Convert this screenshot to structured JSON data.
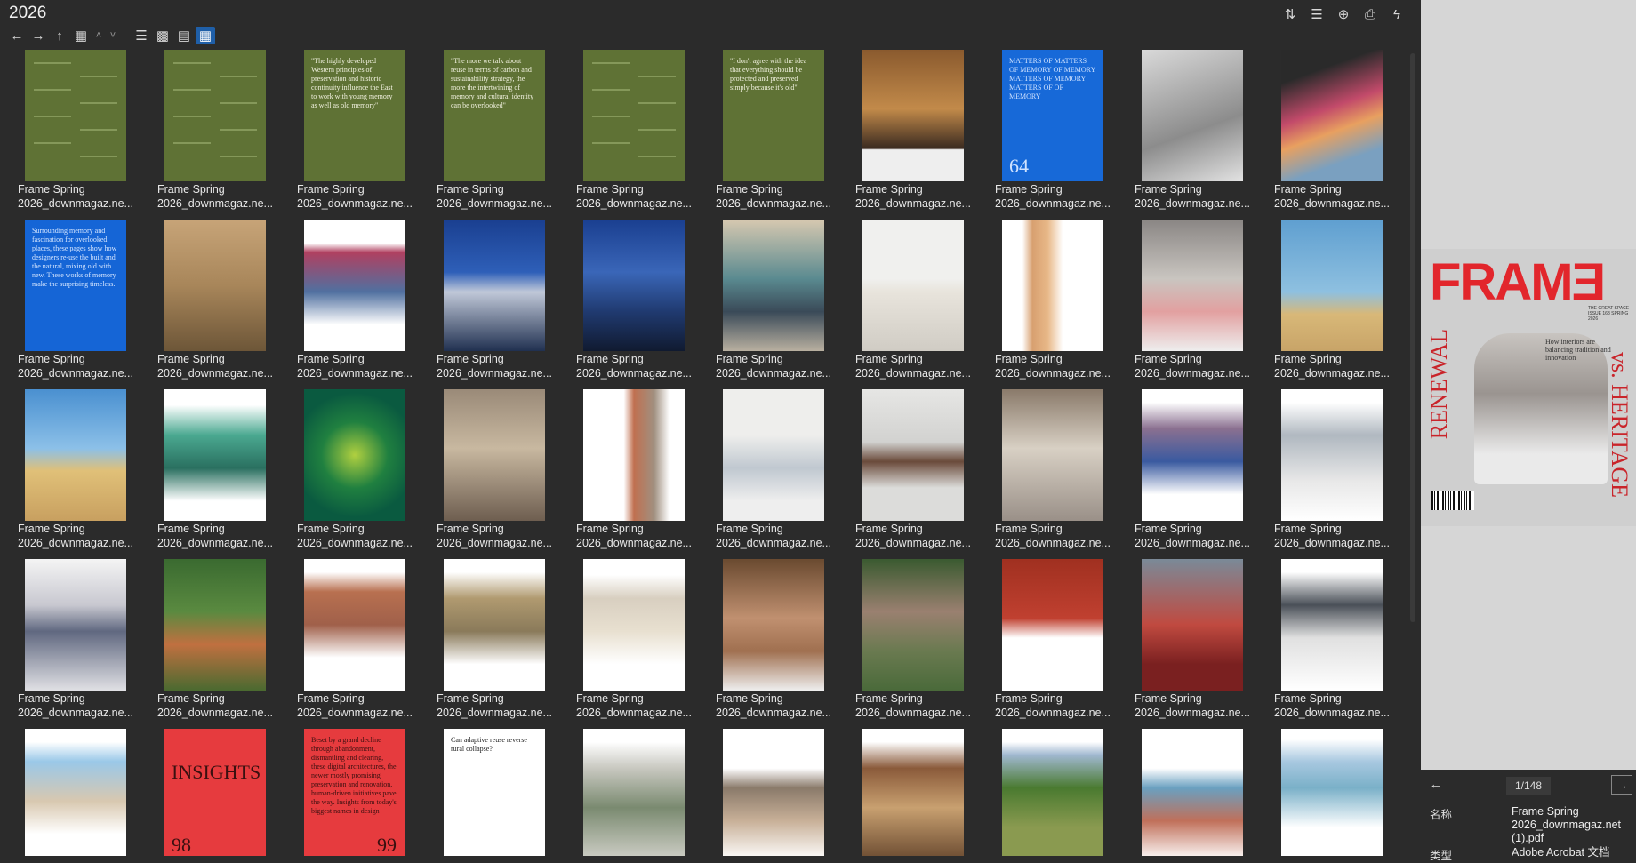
{
  "window": {
    "title": "2026"
  },
  "toolbar": {
    "nav_icons": [
      "back-arrow-icon",
      "forward-arrow-icon",
      "up-arrow-icon",
      "folder-icon",
      "chevron-up-icon",
      "chevron-down-icon"
    ],
    "view_icons": [
      "details-view-icon",
      "list-view-icon",
      "tiles-view-icon",
      "thumbnails-view-icon"
    ],
    "right_icons": [
      "sort-icon",
      "list-icon",
      "add-circle-icon",
      "clipboard-icon",
      "bolt-icon"
    ]
  },
  "grid": {
    "label_line1": "Frame Spring",
    "label_line2": "2026_downmagaz.ne...",
    "items": [
      {
        "type": "text",
        "bg": "#5f7235",
        "fg": "#cfe0a0",
        "text": ""
      },
      {
        "type": "text",
        "bg": "#5f7235",
        "fg": "#cfe0a0",
        "text": ""
      },
      {
        "type": "text",
        "bg": "#5f7235",
        "fg": "#f2f2e0",
        "text": "\"The highly developed Western principles of preservation and historic continuity influence the East to work with young memory as well as old memory\""
      },
      {
        "type": "text",
        "bg": "#5f7235",
        "fg": "#f2f2e0",
        "text": "\"The more we talk about reuse in terms of carbon and sustainability strategy, the more the intertwining of memory and cultural identity can be overlooked\""
      },
      {
        "type": "text",
        "bg": "#5f7235",
        "fg": "#cfe0a0",
        "text": ""
      },
      {
        "type": "text",
        "bg": "#5f7235",
        "fg": "#f2f2e0",
        "text": "\"I don't agree with the idea that everything should be protected and preserved simply because it's old\""
      },
      {
        "type": "img",
        "bg": "linear-gradient(180deg,#8a5a2e 0%,#c28a4a 45%,#3a2a20 75%,#eee 76%)"
      },
      {
        "type": "text",
        "bg": "#1769d8",
        "fg": "#cfe2ff",
        "text": "MATTERS OF MATTERS OF MEMORY OF MEMORY MATTERS OF MEMORY MATTERS OF OF MEMORY",
        "num": "64"
      },
      {
        "type": "img",
        "bg": "linear-gradient(160deg,#d9d9d9,#8c8c8c 60%,#e2e2e2)"
      },
      {
        "type": "img",
        "bg": "linear-gradient(160deg,#2a2a2a 20%,#c24a6a 45%,#e8a060 60%,#7aa0c0 80%)"
      },
      {
        "type": "text",
        "bg": "#1565d6",
        "fg": "#d6e6ff",
        "text": "Surrounding memory and fascination for overlooked places, these pages show how designers re-use the built and the natural, mixing old with new. These works of memory make the surprising timeless."
      },
      {
        "type": "img",
        "bg": "linear-gradient(180deg,#c7a478,#a8865a 50%,#6d5638)"
      },
      {
        "type": "img",
        "bg": "linear-gradient(180deg,#fff 0 18%,#b04060 25%,#5070a0 55%,#fff 80%)"
      },
      {
        "type": "img",
        "bg": "linear-gradient(180deg,#1a3f90,#2e5fb8 40%,#c0c8d8 55%,#203050)"
      },
      {
        "type": "img",
        "bg": "linear-gradient(180deg,#1a3f90,#3a66b8 40%,#203a70 70%,#101a30)"
      },
      {
        "type": "img",
        "bg": "linear-gradient(180deg,#d6c8b0,#5a8a90 45%,#3a4a58 70%,#b9b0a0)"
      },
      {
        "type": "img",
        "bg": "linear-gradient(180deg,#f0f0ee 0 45%,#e8e4dc 55%,#d0ccc4)"
      },
      {
        "type": "img",
        "bg": "linear-gradient(90deg,#fff 0 20%,#d8a070 30%,#e8b888 45%,#fff 60%)"
      },
      {
        "type": "img",
        "bg": "linear-gradient(180deg,#8a8684,#c9c5c0 45%,#e2a0a0 70%,#eee)"
      },
      {
        "type": "img",
        "bg": "linear-gradient(180deg,#5f9fd0,#8ec0e0 55%,#d8b878 72%,#c8a468)"
      },
      {
        "type": "img",
        "bg": "linear-gradient(180deg,#4a90d0,#8cc0e8 45%,#e0c078 62%,#c8a060)"
      },
      {
        "type": "img",
        "bg": "linear-gradient(180deg,#fff 0 12%,#4aa890 35%,#2a7060 60%,#fff 85%)"
      },
      {
        "type": "img",
        "bg": "radial-gradient(circle at 50% 50%,#b0d040,#208040 40%,#0a5a40 75%)"
      },
      {
        "type": "img",
        "bg": "linear-gradient(180deg,#9a8a78,#c8b8a0 45%,#6e5e50)"
      },
      {
        "type": "img",
        "bg": "linear-gradient(90deg,#fff 0 40%,#c07050 50%,#a09080 70%,#fff 85%)"
      },
      {
        "type": "img",
        "bg": "linear-gradient(180deg,#eeeeec 0 35%,#c0c8d0 60%,#eee 85%)"
      },
      {
        "type": "img",
        "bg": "linear-gradient(180deg,#e6e6e4,#d2d2d0 40%,#6a4a3a 55%,#dcdcda 75%)"
      },
      {
        "type": "img",
        "bg": "linear-gradient(180deg,#8a7a6a,#d8d0c4 45%,#9a9088)"
      },
      {
        "type": "img",
        "bg": "linear-gradient(180deg,#fff 0 10%,#8a7090 30%,#3a5aa0 55%,#fff 80%)"
      },
      {
        "type": "img",
        "bg": "linear-gradient(180deg,#fff 0 10%,#b0b8c0 35%,#e8e8e8 70%,#fff)"
      },
      {
        "type": "img",
        "bg": "linear-gradient(180deg,#f4f4f4,#c8c8d0 35%,#606880 55%,#e0e0e4)"
      },
      {
        "type": "img",
        "bg": "linear-gradient(180deg,#3a6a30,#5a8a40 40%,#c07040 65%,#4a6a30)"
      },
      {
        "type": "img",
        "bg": "linear-gradient(180deg,#fff 0 10%,#b87050 25%,#a0604a 50%,#fff 75%)"
      },
      {
        "type": "img",
        "bg": "linear-gradient(180deg,#fff 0 10%,#b09a70 30%,#8a7a5a 55%,#fff 80%)"
      },
      {
        "type": "img",
        "bg": "linear-gradient(180deg,#fff 0 12%,#d8cfc0 30%,#e8e0d0 55%,#fff 80%)"
      },
      {
        "type": "img",
        "bg": "linear-gradient(180deg,#6a4a30,#c09070 45%,#a07050 70%,#eee)"
      },
      {
        "type": "img",
        "bg": "linear-gradient(180deg,#3a5a30,#9a8070 40%,#6a7a50 70%,#4a6a3a)"
      },
      {
        "type": "img",
        "bg": "linear-gradient(180deg,#a03020,#c04030 45%,#fff 60%)"
      },
      {
        "type": "img",
        "bg": "linear-gradient(180deg,#7a8a98,#c04a40 50%,#7a2020 80%)"
      },
      {
        "type": "img",
        "bg": "linear-gradient(180deg,#fff 0 10%,#4a5058 35%,#e0e0e0 60%,#fff)"
      },
      {
        "type": "img",
        "bg": "linear-gradient(180deg,#fff 0 10%,#9ac8e8 25%,#d8c8b0 55%,#fff 80%)"
      },
      {
        "type": "text",
        "bg": "#e63b3e",
        "fg": "#3a1010",
        "text": "INSIGHTS",
        "num": "98",
        "big": true
      },
      {
        "type": "text",
        "bg": "#e63b3e",
        "fg": "#3a1010",
        "text": "Beset by a grand decline through abandonment, dismantling and clearing, these digital architectures, the newer mostly promising preservation and renovation, human-driven initiatives pave the way. Insights from today's biggest names in design",
        "num": "99"
      },
      {
        "type": "text",
        "bg": "#ffffff",
        "fg": "#222",
        "text": "Can adaptive reuse reverse rural collapse?"
      },
      {
        "type": "img",
        "bg": "linear-gradient(180deg,#fff 0 10%,#c8c8c0 30%,#7a8a70 60%,#d0d0c8)"
      },
      {
        "type": "img",
        "bg": "linear-gradient(180deg,#fff 0 30%,#8a7a6a 45%,#c8b098 70%,#fff)"
      },
      {
        "type": "img",
        "bg": "linear-gradient(180deg,#fff 0 10%,#8a5a3a 30%,#c8a070 60%,#6a4a30)"
      },
      {
        "type": "img",
        "bg": "linear-gradient(180deg,#fff 0 10%,#a0b8d0 20%,#4a7a30 45%,#8a9a50 75%)"
      },
      {
        "type": "img",
        "bg": "linear-gradient(180deg,#fff 0 30%,#6aa0c0 45%,#c0705a 70%,#fff)"
      },
      {
        "type": "img",
        "bg": "linear-gradient(180deg,#fff 0 8%,#a8c8e0 25%,#7ab0c8 45%,#fff 75%)"
      }
    ]
  },
  "sidebar": {
    "preview": {
      "logo": "FRAMƎ",
      "left_text": "RENEWAL",
      "right_text": "vs. HERITAGE",
      "subtitle": "How interiors are balancing tradition and innovation",
      "issue_text": "THE GREAT SPACE ISSUE 168 SPRING 2026"
    },
    "pager": {
      "page": "1/148"
    },
    "meta": [
      {
        "key": "名称",
        "value": "Frame Spring 2026_downmagaz.net (1).pdf"
      },
      {
        "key": "类型",
        "value": "Adobe Acrobat 文档"
      }
    ]
  },
  "colors": {
    "accent": "#1f5fa8",
    "bg": "#2b2b2b",
    "sidebar_bg": "#d6d6d6"
  }
}
